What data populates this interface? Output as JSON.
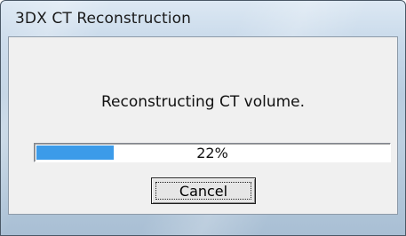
{
  "window": {
    "title": "3DX CT Reconstruction"
  },
  "dialog": {
    "message": "Reconstructing CT volume.",
    "progress": {
      "percent": 22,
      "text": "22%",
      "fill_color": "#3c9be9"
    },
    "cancel_label": "Cancel"
  }
}
